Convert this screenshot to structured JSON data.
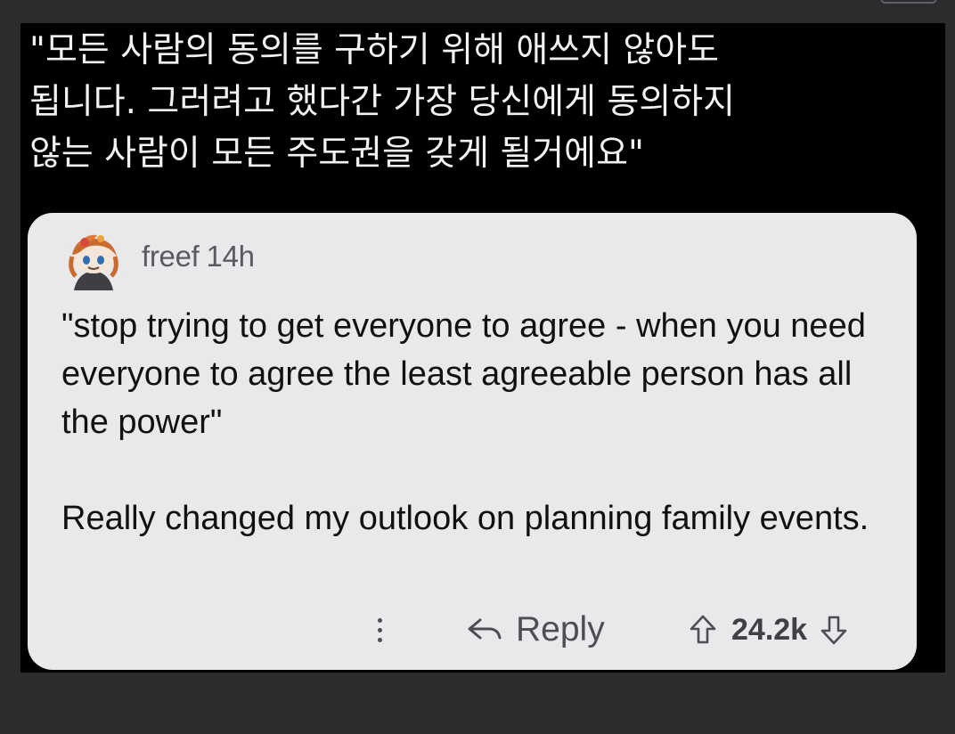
{
  "caption": {
    "lines": [
      "\"모든 사람의 동의를 구하기 위해 애쓰지 않아도",
      "됩니다. 그러려고 했다간 가장 당신에게 동의하지",
      "않는 사람이 모든 주도권을 갖게 될거에요\""
    ]
  },
  "comment": {
    "username": "freef",
    "time": "14h",
    "body": [
      "\"stop trying to get everyone to agree - when you need everyone to agree the least agreeable person has all the power\"",
      "Really changed my outlook on planning family events."
    ],
    "avatar_icon": "snoo-avatar-icon"
  },
  "actions": {
    "more_icon": "vertical-dots-icon",
    "reply_icon": "reply-arrow-icon",
    "reply_label": "Reply",
    "upvote_icon": "arrow-up-icon",
    "score": "24.2k",
    "downvote_icon": "arrow-down-icon"
  },
  "colors": {
    "page_background": "#2b2c2e",
    "frame_background": "#000000",
    "card_background": "#e9e9eb",
    "caption_text": "#f2f2f2",
    "body_text": "#111111",
    "meta_text": "#5a5b5e"
  }
}
